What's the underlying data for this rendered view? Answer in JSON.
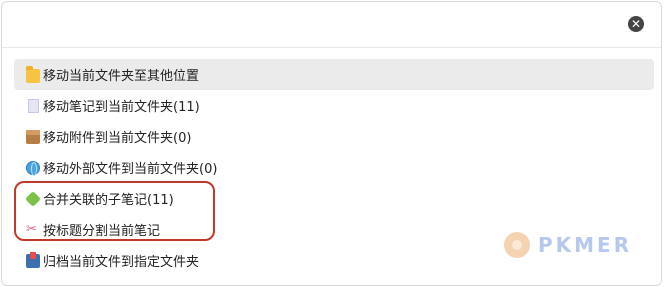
{
  "dialog": {
    "close_icon": "close-icon"
  },
  "menu": {
    "items": [
      {
        "label": "移动当前文件夹至其他位置",
        "icon": "folder-icon",
        "active": true
      },
      {
        "label": "移动笔记到当前文件夹(11)",
        "icon": "note-icon"
      },
      {
        "label": "移动附件到当前文件夹(0)",
        "icon": "package-icon"
      },
      {
        "label": "移动外部文件到当前文件夹(0)",
        "icon": "globe-icon"
      },
      {
        "label": "合并关联的子笔记(11)",
        "icon": "puzzle-icon"
      },
      {
        "label": "按标题分割当前笔记",
        "icon": "scissors-icon"
      },
      {
        "label": "归档当前文件到指定文件夹",
        "icon": "inbox-tray-icon"
      }
    ]
  },
  "watermark": {
    "text": "PKMER"
  },
  "colors": {
    "highlight_border": "#c0392b",
    "active_row": "#ebebeb",
    "watermark_text": "#b6c8ee"
  }
}
